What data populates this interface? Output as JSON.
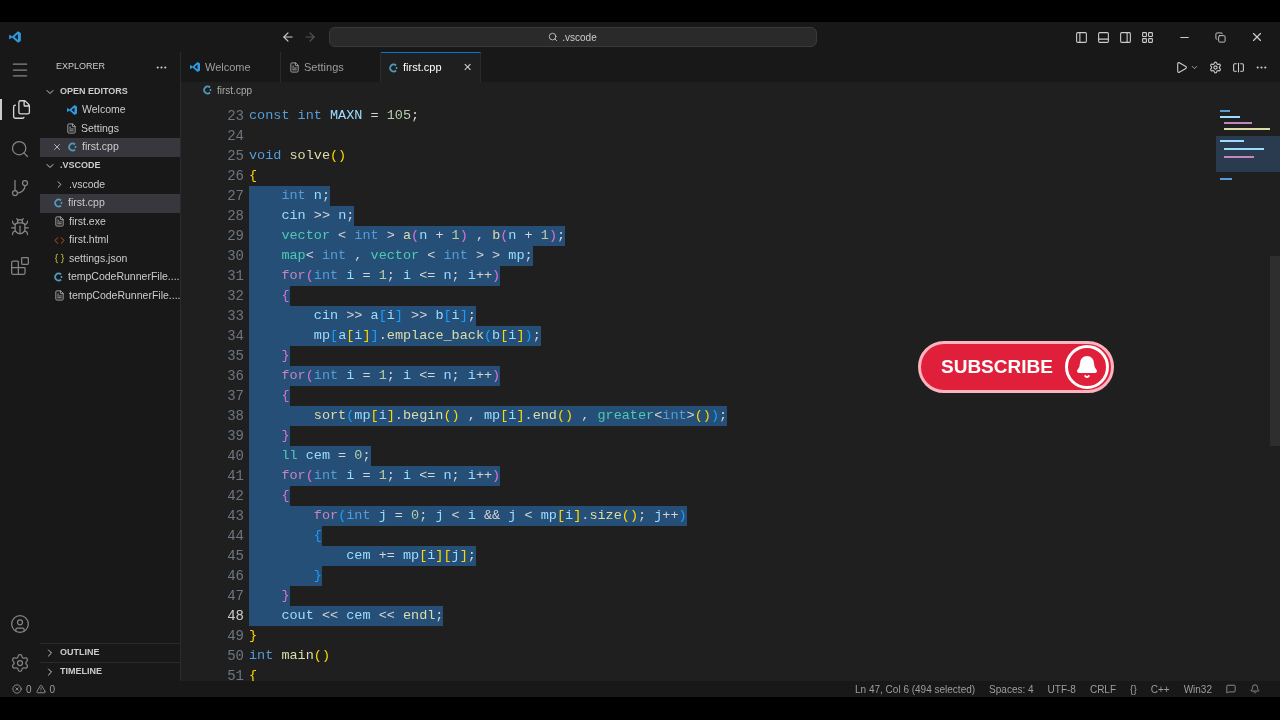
{
  "title_bar": {
    "search": ".vscode"
  },
  "sidebar": {
    "title": "EXPLORER",
    "sections": [
      {
        "label": "OPEN EDITORS",
        "expanded": true,
        "items": [
          {
            "kind": "welcome",
            "label": "Welcome",
            "selected": false,
            "closable": false
          },
          {
            "kind": "lines",
            "label": "Settings",
            "selected": false,
            "closable": false
          },
          {
            "kind": "cpp",
            "label": "first.cpp",
            "selected": true,
            "closable": true
          }
        ]
      },
      {
        "label": ".VSCODE",
        "expanded": true,
        "items": [
          {
            "kind": "folder",
            "label": ".vscode",
            "selected": false,
            "closable": false
          },
          {
            "kind": "cpp",
            "label": "first.cpp",
            "selected": true,
            "closable": false
          },
          {
            "kind": "lines",
            "label": "first.exe",
            "selected": false,
            "closable": false
          },
          {
            "kind": "html",
            "label": "first.html",
            "selected": false,
            "closable": false
          },
          {
            "kind": "json",
            "label": "settings.json",
            "selected": false,
            "closable": false
          },
          {
            "kind": "cpp",
            "label": "tempCodeRunnerFile....",
            "selected": false,
            "closable": false
          },
          {
            "kind": "lines",
            "label": "tempCodeRunnerFile....",
            "selected": false,
            "closable": false
          }
        ]
      }
    ],
    "bottom_sections": [
      {
        "label": "OUTLINE",
        "expanded": false
      },
      {
        "label": "TIMELINE",
        "expanded": false
      }
    ]
  },
  "tabs": [
    {
      "kind": "welcome",
      "label": "Welcome",
      "selected": false
    },
    {
      "kind": "lines",
      "label": "Settings",
      "selected": false
    },
    {
      "kind": "cpp",
      "label": "first.cpp",
      "selected": true,
      "close": "✕"
    }
  ],
  "breadcrumb": "first.cpp",
  "editor": {
    "lines": [
      {
        "number": "23",
        "selected": false,
        "current": false,
        "tokens": [
          {
            "kind": "k",
            "text": "const"
          },
          {
            "kind": "k",
            "text": " int"
          },
          {
            "kind": "v",
            "text": " MAXN"
          },
          {
            "kind": "p",
            "text": " = "
          },
          {
            "kind": "n",
            "text": "105"
          },
          {
            "kind": "p",
            "text": ";"
          }
        ]
      },
      {
        "number": "24",
        "selected": false,
        "current": false
      },
      {
        "number": "25",
        "selected": false,
        "current": false,
        "tokens": [
          {
            "kind": "k",
            "text": "void"
          },
          {
            "kind": "f",
            "text": " solve"
          },
          {
            "kind": "b1",
            "text": "()"
          }
        ]
      },
      {
        "number": "26",
        "selected": false,
        "current": false,
        "tokens": [
          {
            "kind": "b1",
            "text": "{"
          }
        ]
      },
      {
        "number": "27",
        "selected": true,
        "current": false,
        "tokens": [
          {
            "kind": "k",
            "text": "    int"
          },
          {
            "kind": "v",
            "text": " n"
          },
          {
            "kind": "p",
            "text": ";"
          }
        ]
      },
      {
        "number": "28",
        "selected": true,
        "current": false,
        "tokens": [
          {
            "kind": "v",
            "text": "    cin"
          },
          {
            "kind": "p",
            "text": " >> "
          },
          {
            "kind": "v",
            "text": "n"
          },
          {
            "kind": "p",
            "text": ";"
          }
        ]
      },
      {
        "number": "29",
        "selected": true,
        "current": false,
        "tokens": [
          {
            "kind": "t",
            "text": "    vector"
          },
          {
            "kind": "p",
            "text": " < "
          },
          {
            "kind": "k",
            "text": "int"
          },
          {
            "kind": "p",
            "text": " > "
          },
          {
            "kind": "f",
            "text": "a"
          },
          {
            "kind": "b2",
            "text": "("
          },
          {
            "kind": "v",
            "text": "n"
          },
          {
            "kind": "p",
            "text": " + "
          },
          {
            "kind": "n",
            "text": "1"
          },
          {
            "kind": "b2",
            "text": ")"
          },
          {
            "kind": "p",
            "text": " , "
          },
          {
            "kind": "f",
            "text": "b"
          },
          {
            "kind": "b2",
            "text": "("
          },
          {
            "kind": "v",
            "text": "n"
          },
          {
            "kind": "p",
            "text": " + "
          },
          {
            "kind": "n",
            "text": "1"
          },
          {
            "kind": "b2",
            "text": ")"
          },
          {
            "kind": "p",
            "text": ";"
          }
        ]
      },
      {
        "number": "30",
        "selected": true,
        "current": false,
        "tokens": [
          {
            "kind": "t",
            "text": "    map"
          },
          {
            "kind": "p",
            "text": "< "
          },
          {
            "kind": "k",
            "text": "int"
          },
          {
            "kind": "p",
            "text": " , "
          },
          {
            "kind": "t",
            "text": "vector"
          },
          {
            "kind": "p",
            "text": " < "
          },
          {
            "kind": "k",
            "text": "int"
          },
          {
            "kind": "p",
            "text": " > > "
          },
          {
            "kind": "v",
            "text": "mp"
          },
          {
            "kind": "p",
            "text": ";"
          }
        ]
      },
      {
        "number": "31",
        "selected": true,
        "current": false,
        "tokens": [
          {
            "kind": "c",
            "text": "    for"
          },
          {
            "kind": "b2",
            "text": "("
          },
          {
            "kind": "k",
            "text": "int"
          },
          {
            "kind": "v",
            "text": " i"
          },
          {
            "kind": "p",
            "text": " = "
          },
          {
            "kind": "n",
            "text": "1"
          },
          {
            "kind": "p",
            "text": "; "
          },
          {
            "kind": "v",
            "text": "i"
          },
          {
            "kind": "p",
            "text": " <= "
          },
          {
            "kind": "v",
            "text": "n"
          },
          {
            "kind": "p",
            "text": "; "
          },
          {
            "kind": "v",
            "text": "i"
          },
          {
            "kind": "p",
            "text": "++"
          },
          {
            "kind": "b2",
            "text": ")"
          }
        ]
      },
      {
        "number": "32",
        "selected": true,
        "current": false,
        "tokens": [
          {
            "kind": "b2",
            "text": "    {"
          }
        ]
      },
      {
        "number": "33",
        "selected": true,
        "current": false,
        "tokens": [
          {
            "kind": "v",
            "text": "        cin"
          },
          {
            "kind": "p",
            "text": " >> "
          },
          {
            "kind": "v",
            "text": "a"
          },
          {
            "kind": "b3",
            "text": "["
          },
          {
            "kind": "v",
            "text": "i"
          },
          {
            "kind": "b3",
            "text": "]"
          },
          {
            "kind": "p",
            "text": " >> "
          },
          {
            "kind": "v",
            "text": "b"
          },
          {
            "kind": "b3",
            "text": "["
          },
          {
            "kind": "v",
            "text": "i"
          },
          {
            "kind": "b3",
            "text": "]"
          },
          {
            "kind": "p",
            "text": ";"
          }
        ]
      },
      {
        "number": "34",
        "selected": true,
        "current": false,
        "tokens": [
          {
            "kind": "v",
            "text": "        mp"
          },
          {
            "kind": "b3",
            "text": "["
          },
          {
            "kind": "v",
            "text": "a"
          },
          {
            "kind": "b1",
            "text": "["
          },
          {
            "kind": "v",
            "text": "i"
          },
          {
            "kind": "b1",
            "text": "]"
          },
          {
            "kind": "b3",
            "text": "]"
          },
          {
            "kind": "p",
            "text": "."
          },
          {
            "kind": "f",
            "text": "emplace_back"
          },
          {
            "kind": "b3",
            "text": "("
          },
          {
            "kind": "v",
            "text": "b"
          },
          {
            "kind": "b1",
            "text": "["
          },
          {
            "kind": "v",
            "text": "i"
          },
          {
            "kind": "b1",
            "text": "]"
          },
          {
            "kind": "b3",
            "text": ")"
          },
          {
            "kind": "p",
            "text": ";"
          }
        ]
      },
      {
        "number": "35",
        "selected": true,
        "current": false,
        "tokens": [
          {
            "kind": "b2",
            "text": "    }"
          }
        ]
      },
      {
        "number": "36",
        "selected": true,
        "current": false,
        "tokens": [
          {
            "kind": "c",
            "text": "    for"
          },
          {
            "kind": "b2",
            "text": "("
          },
          {
            "kind": "k",
            "text": "int"
          },
          {
            "kind": "v",
            "text": " i"
          },
          {
            "kind": "p",
            "text": " = "
          },
          {
            "kind": "n",
            "text": "1"
          },
          {
            "kind": "p",
            "text": "; "
          },
          {
            "kind": "v",
            "text": "i"
          },
          {
            "kind": "p",
            "text": " <= "
          },
          {
            "kind": "v",
            "text": "n"
          },
          {
            "kind": "p",
            "text": "; "
          },
          {
            "kind": "v",
            "text": "i"
          },
          {
            "kind": "p",
            "text": "++"
          },
          {
            "kind": "b2",
            "text": ")"
          }
        ]
      },
      {
        "number": "37",
        "selected": true,
        "current": false,
        "tokens": [
          {
            "kind": "b2",
            "text": "    {"
          }
        ]
      },
      {
        "number": "38",
        "selected": true,
        "current": false,
        "tokens": [
          {
            "kind": "f",
            "text": "        sort"
          },
          {
            "kind": "b3",
            "text": "("
          },
          {
            "kind": "v",
            "text": "mp"
          },
          {
            "kind": "b1",
            "text": "["
          },
          {
            "kind": "v",
            "text": "i"
          },
          {
            "kind": "b1",
            "text": "]"
          },
          {
            "kind": "p",
            "text": "."
          },
          {
            "kind": "f",
            "text": "begin"
          },
          {
            "kind": "b1",
            "text": "()"
          },
          {
            "kind": "p",
            "text": " , "
          },
          {
            "kind": "v",
            "text": "mp"
          },
          {
            "kind": "b1",
            "text": "["
          },
          {
            "kind": "v",
            "text": "i"
          },
          {
            "kind": "b1",
            "text": "]"
          },
          {
            "kind": "p",
            "text": "."
          },
          {
            "kind": "f",
            "text": "end"
          },
          {
            "kind": "b1",
            "text": "()"
          },
          {
            "kind": "p",
            "text": " , "
          },
          {
            "kind": "t",
            "text": "greater"
          },
          {
            "kind": "p",
            "text": "<"
          },
          {
            "kind": "k",
            "text": "int"
          },
          {
            "kind": "p",
            "text": ">"
          },
          {
            "kind": "b1",
            "text": "()"
          },
          {
            "kind": "b3",
            "text": ")"
          },
          {
            "kind": "p",
            "text": ";"
          }
        ]
      },
      {
        "number": "39",
        "selected": true,
        "current": false,
        "tokens": [
          {
            "kind": "b2",
            "text": "    }"
          }
        ]
      },
      {
        "number": "40",
        "selected": true,
        "current": false,
        "tokens": [
          {
            "kind": "t",
            "text": "    ll"
          },
          {
            "kind": "v",
            "text": " cem"
          },
          {
            "kind": "p",
            "text": " = "
          },
          {
            "kind": "n",
            "text": "0"
          },
          {
            "kind": "p",
            "text": ";"
          }
        ]
      },
      {
        "number": "41",
        "selected": true,
        "current": false,
        "tokens": [
          {
            "kind": "c",
            "text": "    for"
          },
          {
            "kind": "b2",
            "text": "("
          },
          {
            "kind": "k",
            "text": "int"
          },
          {
            "kind": "v",
            "text": " i"
          },
          {
            "kind": "p",
            "text": " = "
          },
          {
            "kind": "n",
            "text": "1"
          },
          {
            "kind": "p",
            "text": "; "
          },
          {
            "kind": "v",
            "text": "i"
          },
          {
            "kind": "p",
            "text": " <= "
          },
          {
            "kind": "v",
            "text": "n"
          },
          {
            "kind": "p",
            "text": "; "
          },
          {
            "kind": "v",
            "text": "i"
          },
          {
            "kind": "p",
            "text": "++"
          },
          {
            "kind": "b2",
            "text": ")"
          }
        ]
      },
      {
        "number": "42",
        "selected": true,
        "current": false,
        "tokens": [
          {
            "kind": "b2",
            "text": "    {"
          }
        ]
      },
      {
        "number": "43",
        "selected": true,
        "current": false,
        "tokens": [
          {
            "kind": "c",
            "text": "        for"
          },
          {
            "kind": "b3",
            "text": "("
          },
          {
            "kind": "k",
            "text": "int"
          },
          {
            "kind": "v",
            "text": " j"
          },
          {
            "kind": "p",
            "text": " = "
          },
          {
            "kind": "n",
            "text": "0"
          },
          {
            "kind": "p",
            "text": "; "
          },
          {
            "kind": "v",
            "text": "j"
          },
          {
            "kind": "p",
            "text": " < "
          },
          {
            "kind": "v",
            "text": "i"
          },
          {
            "kind": "p",
            "text": " && "
          },
          {
            "kind": "v",
            "text": "j"
          },
          {
            "kind": "p",
            "text": " < "
          },
          {
            "kind": "v",
            "text": "mp"
          },
          {
            "kind": "b1",
            "text": "["
          },
          {
            "kind": "v",
            "text": "i"
          },
          {
            "kind": "b1",
            "text": "]"
          },
          {
            "kind": "p",
            "text": "."
          },
          {
            "kind": "f",
            "text": "size"
          },
          {
            "kind": "b1",
            "text": "()"
          },
          {
            "kind": "p",
            "text": "; "
          },
          {
            "kind": "v",
            "text": "j"
          },
          {
            "kind": "p",
            "text": "++"
          },
          {
            "kind": "b3",
            "text": ")"
          }
        ]
      },
      {
        "number": "44",
        "selected": true,
        "current": false,
        "tokens": [
          {
            "kind": "b3",
            "text": "        {"
          }
        ]
      },
      {
        "number": "45",
        "selected": true,
        "current": false,
        "tokens": [
          {
            "kind": "v",
            "text": "            cem"
          },
          {
            "kind": "p",
            "text": " += "
          },
          {
            "kind": "v",
            "text": "mp"
          },
          {
            "kind": "b1",
            "text": "["
          },
          {
            "kind": "v",
            "text": "i"
          },
          {
            "kind": "b1",
            "text": "]["
          },
          {
            "kind": "v",
            "text": "j"
          },
          {
            "kind": "b1",
            "text": "]"
          },
          {
            "kind": "p",
            "text": ";"
          }
        ]
      },
      {
        "number": "46",
        "selected": true,
        "current": false,
        "tokens": [
          {
            "kind": "b3",
            "text": "        }"
          }
        ]
      },
      {
        "number": "47",
        "selected": true,
        "current": false,
        "tokens": [
          {
            "kind": "b2",
            "text": "    }"
          }
        ]
      },
      {
        "number": "48",
        "selected": true,
        "current": true,
        "tokens": [
          {
            "kind": "v",
            "text": "    cout"
          },
          {
            "kind": "p",
            "text": " << "
          },
          {
            "kind": "v",
            "text": "cem"
          },
          {
            "kind": "p",
            "text": " << "
          },
          {
            "kind": "f",
            "text": "endl"
          },
          {
            "kind": "p",
            "text": ";"
          }
        ]
      },
      {
        "number": "49",
        "selected": false,
        "current": false,
        "tokens": [
          {
            "kind": "b1",
            "text": "}"
          }
        ]
      },
      {
        "number": "50",
        "selected": false,
        "current": false,
        "tokens": [
          {
            "kind": "k",
            "text": "int"
          },
          {
            "kind": "f",
            "text": " main"
          },
          {
            "kind": "b1",
            "text": "()"
          }
        ]
      },
      {
        "number": "51",
        "selected": false,
        "current": false,
        "tokens": [
          {
            "kind": "b1",
            "text": "{"
          }
        ]
      }
    ]
  },
  "overlay": {
    "label": "SUBSCRIBE"
  },
  "status_bar": {
    "errors": "0",
    "warnings": "0",
    "items": [
      "Ln 47, Col 6 (494 selected)",
      "Spaces: 4",
      "UTF-8",
      "CRLF",
      "{}",
      "C++",
      "Win32"
    ]
  }
}
